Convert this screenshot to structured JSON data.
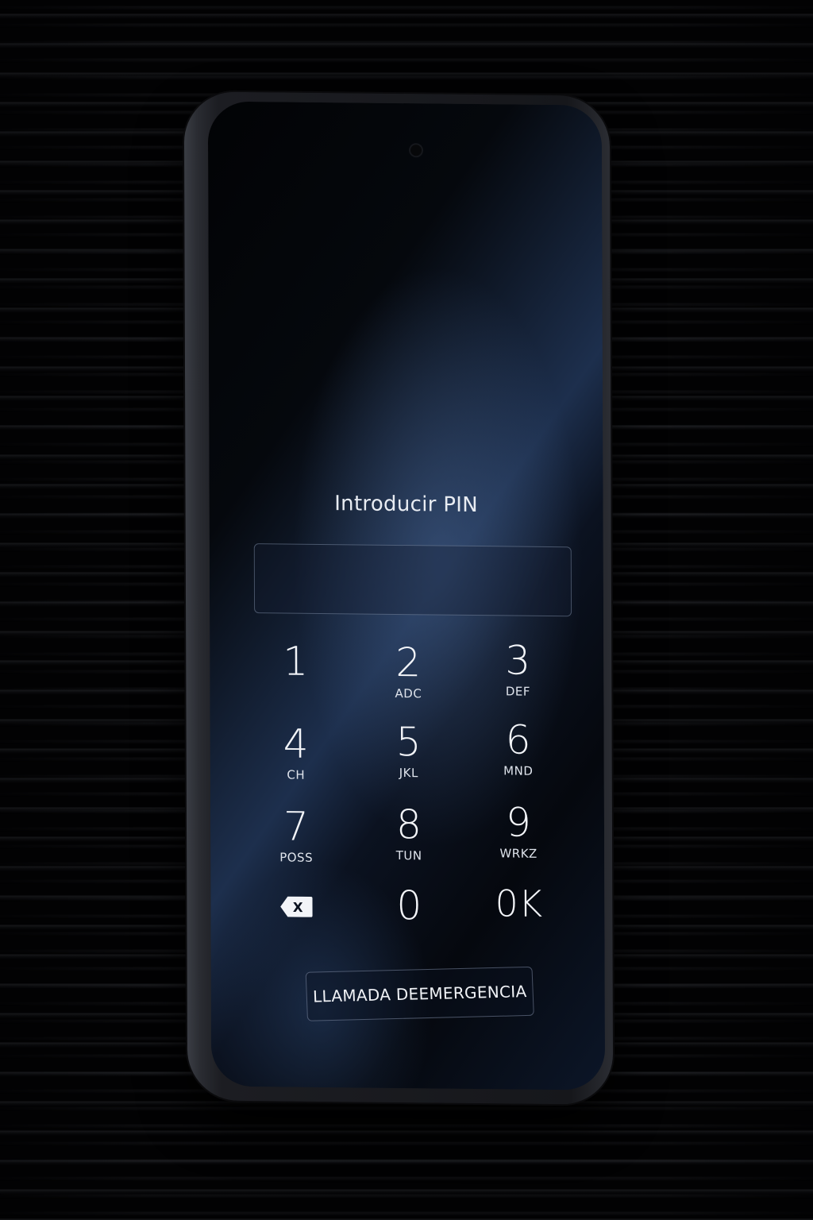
{
  "lock_screen": {
    "title": "Introducir PIN",
    "pin_field": {
      "value": "",
      "placeholder": ""
    },
    "keypad": {
      "keys": [
        {
          "digit": "1",
          "letters": ""
        },
        {
          "digit": "2",
          "letters": "ADC"
        },
        {
          "digit": "3",
          "letters": "DEF"
        },
        {
          "digit": "4",
          "letters": "CH"
        },
        {
          "digit": "5",
          "letters": "JKL"
        },
        {
          "digit": "6",
          "letters": "MND"
        },
        {
          "digit": "7",
          "letters": "POSS"
        },
        {
          "digit": "8",
          "letters": "TUN"
        },
        {
          "digit": "9",
          "letters": "WRKZ"
        },
        {
          "digit": "0",
          "letters": ""
        }
      ],
      "ok_label": "0K",
      "backspace_icon": "backspace-icon",
      "backspace_glyph": "X"
    },
    "emergency_label": "LLAMADA DEEMERGENCIA"
  },
  "colors": {
    "text": "#f2f4f8",
    "accent_blue": "#1d2f4d",
    "background": "#020203"
  }
}
